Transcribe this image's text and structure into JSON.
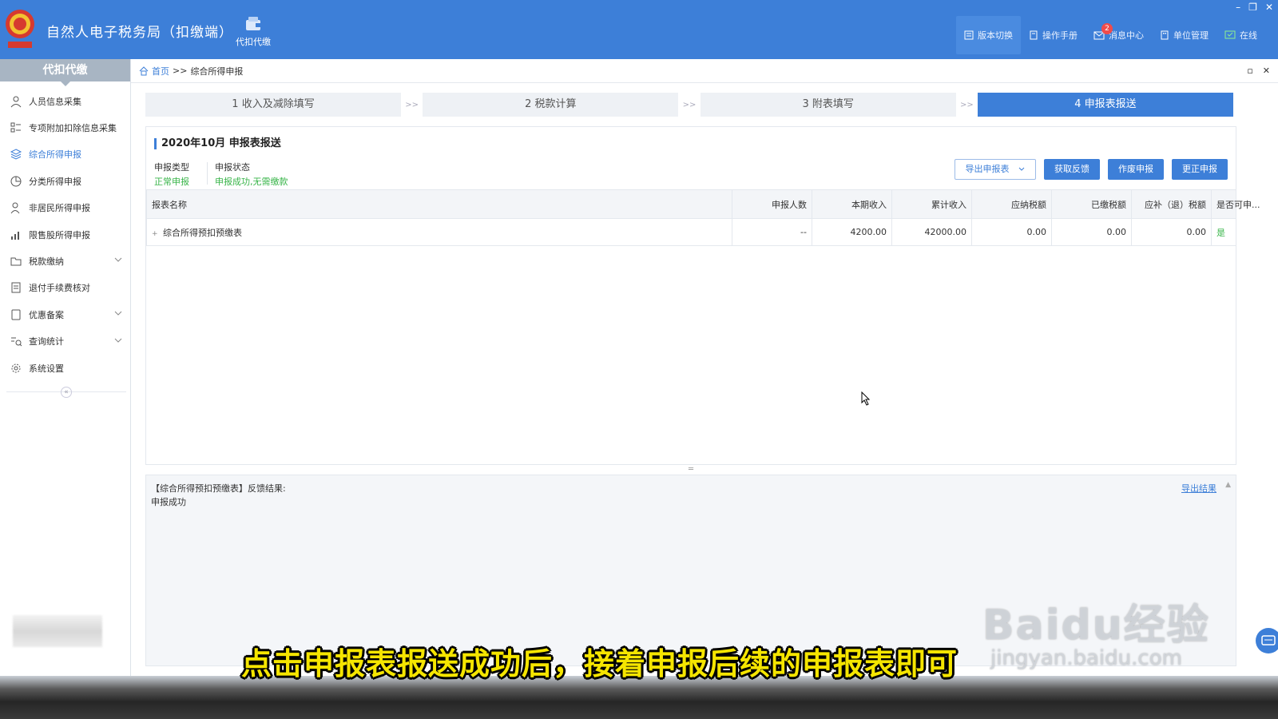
{
  "header": {
    "title": "自然人电子税务局（扣缴端）",
    "module": "代扣代缴",
    "actions": [
      {
        "label": "版本切换",
        "icon": "switch-icon"
      },
      {
        "label": "操作手册",
        "icon": "manual-icon"
      },
      {
        "label": "消息中心",
        "icon": "mail-icon",
        "badge": "2"
      },
      {
        "label": "单位管理",
        "icon": "building-icon"
      },
      {
        "label": "在线",
        "icon": "online-icon"
      }
    ],
    "window_controls": [
      "–",
      "❐",
      "✕"
    ]
  },
  "sidebar": {
    "title": "代扣代缴",
    "items": [
      {
        "label": "人员信息采集"
      },
      {
        "label": "专项附加扣除信息采集"
      },
      {
        "label": "综合所得申报"
      },
      {
        "label": "分类所得申报"
      },
      {
        "label": "非居民所得申报"
      },
      {
        "label": "限售股所得申报"
      },
      {
        "label": "税款缴纳"
      },
      {
        "label": "退付手续费核对"
      },
      {
        "label": "优惠备案"
      },
      {
        "label": "查询统计"
      },
      {
        "label": "系统设置"
      }
    ]
  },
  "breadcrumb": {
    "home": "首页",
    "sep": ">>",
    "current": "综合所得申报"
  },
  "steps": [
    "1 收入及减除填写",
    "2 税款计算",
    "3 附表填写",
    "4 申报表报送"
  ],
  "step_sep": ">>",
  "panel": {
    "title": "2020年10月  申报表报送",
    "meta": {
      "type_label": "申报类型",
      "type_value": "正常申报",
      "status_label": "申报状态",
      "status_value": "申报成功,无需缴款"
    },
    "buttons": {
      "export": "导出申报表",
      "feedback": "获取反馈",
      "void": "作废申报",
      "correct": "更正申报"
    }
  },
  "table": {
    "headers": [
      "报表名称",
      "申报人数",
      "本期收入",
      "累计收入",
      "应纳税额",
      "已缴税额",
      "应补（退）税额",
      "是否可申..."
    ],
    "rows": [
      [
        "综合所得预扣预缴表",
        "--",
        "4200.00",
        "42000.00",
        "0.00",
        "0.00",
        "0.00",
        "是"
      ]
    ]
  },
  "result": {
    "line1": "【综合所得预扣预缴表】反馈结果:",
    "line2": "申报成功",
    "export_link": "导出结果"
  },
  "overlay": {
    "subtitle": "点击申报表报送成功后，接着申报后续的申报表即可",
    "watermark_main": "Baidu经验",
    "watermark_sub": "jingyan.baidu.com"
  },
  "colors": {
    "primary": "#3d7fd8",
    "success": "#39b54a",
    "subtitle": "#f5e500"
  }
}
